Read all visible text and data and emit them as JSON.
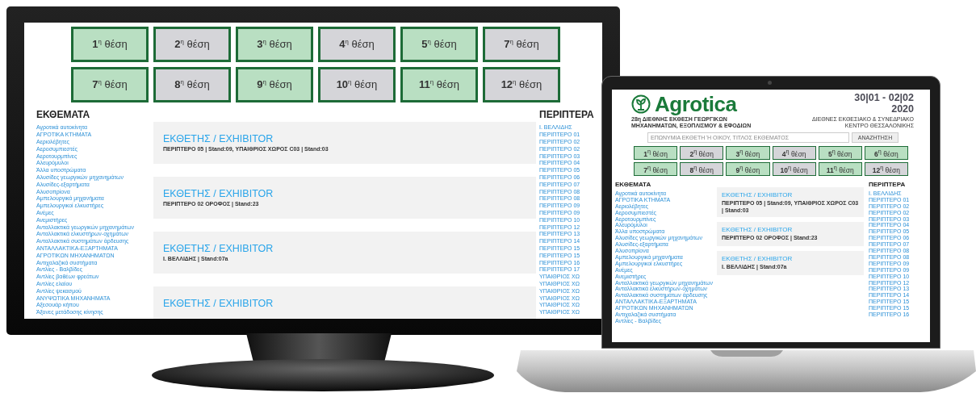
{
  "monitor": {
    "position_buttons": [
      {
        "label": "**1**$^{η}$ θέση",
        "highlighted": true
      },
      {
        "label": "**2**$^{η}$ θέση",
        "highlighted": false
      },
      {
        "label": "**3**$^{η}$ θέση",
        "highlighted": true
      },
      {
        "label": "**4**$^{η}$ θέση",
        "highlighted": false
      },
      {
        "label": "**5**$^{η}$ θέση",
        "highlighted": true
      },
      {
        "label": "**7**$^{η}$ θέση",
        "highlighted": false
      },
      {
        "label": "**7**$^{η}$ θέση",
        "highlighted": true
      },
      {
        "label": "**8**$^{η}$ θέση",
        "highlighted": false
      },
      {
        "label": "**9**$^{η}$ θέση",
        "highlighted": true
      },
      {
        "label": "**10**$^{η}$ θέση",
        "highlighted": false
      },
      {
        "label": "**11**$^{η}$ θέση",
        "highlighted": true
      },
      {
        "label": "**12**$^{η}$ θέση",
        "highlighted": false
      }
    ],
    "exhibits": {
      "title": "ΕΚΘΕΜΑΤΑ",
      "items": [
        "Αγροτικά αυτοκίνητα",
        "ΑΓΡΟΤΙΚΑ ΚΤΗΜΑΤΑ",
        "Αεριολέβητες",
        "Αεροσυμπιεστές",
        "Αεροτουρμπίνες",
        "Αλευρόμυλοι",
        "Άλλα υποστρώματα",
        "Αλυσίδες γεωργικών μηχανημάτων",
        "Αλυσίδες-εξαρτήματα",
        "Αλυσοπρίονα",
        "Αμπελουργικά μηχανήματα",
        "Αμπελουργικοί ελκυστήρες",
        "Ανέμες",
        "Ανεμιστήρες",
        "Ανταλλακτικά γεωργικών μηχανημάτων",
        "Ανταλλακτικά ελκυστήρων-οχημάτων",
        "Ανταλλακτικά συστημάτων άρδευσης",
        "ΑΝΤΑΛΛΑΚΤΙΚΑ-ΕΞΑΡΤΗΜΑΤΑ ΑΓΡΟΤΙΚΩΝ ΜΗΧΑΝΗΜΑΤΩΝ",
        "Αντιχαλαζικά συστήματα",
        "Αντλίες - Βαλβίδες",
        "Αντλίες βαθέων φρεάτων",
        "Αντλίες ελαίου",
        "Αντλίες ψεκασμού",
        "ΑΝΥΨΩΤΙΚΑ ΜΗΧΑΝΗΜΑΤΑ",
        "Αξεσουάρ κήπου",
        "Άξονες μετάδοσης κίνησης"
      ]
    },
    "exhibitors": [
      {
        "title": "ΕΚΘΕΤΗΣ / EXHIBITOR",
        "location": "ΠΕΡΙΠΤΕΡΟ 05 | Stand:09, ΥΠΑΙΘΡΙΟΣ ΧΩΡΟΣ C03 | Stand:03"
      },
      {
        "title": "ΕΚΘΕΤΗΣ / EXHIBITOR",
        "location": "ΠΕΡΙΠΤΕΡΟ 02 ΟΡΟΦΟΣ | Stand:23"
      },
      {
        "title": "ΕΚΘΕΤΗΣ / EXHIBITOR",
        "location": "Ι. ΒΕΛΛΙΔΗΣ | Stand:07a"
      },
      {
        "title": "ΕΚΘΕΤΗΣ / EXHIBITOR"
      }
    ],
    "booths": {
      "title": "ΠΕΡΙΠΤΕΡΑ",
      "items": [
        "Ι. ΒΕΛΛΙΔΗΣ",
        "ΠΕΡΙΠΤΕΡΟ 01",
        "ΠΕΡΙΠΤΕΡΟ 02",
        "ΠΕΡΙΠΤΕΡΟ 02",
        "ΠΕΡΙΠΤΕΡΟ 03",
        "ΠΕΡΙΠΤΕΡΟ 04",
        "ΠΕΡΙΠΤΕΡΟ 05",
        "ΠΕΡΙΠΤΕΡΟ 06",
        "ΠΕΡΙΠΤΕΡΟ 07",
        "ΠΕΡΙΠΤΕΡΟ 08",
        "ΠΕΡΙΠΤΕΡΟ 08",
        "ΠΕΡΙΠΤΕΡΟ 09",
        "ΠΕΡΙΠΤΕΡΟ 09",
        "ΠΕΡΙΠΤΕΡΟ 10",
        "ΠΕΡΙΠΤΕΡΟ 12",
        "ΠΕΡΙΠΤΕΡΟ 13",
        "ΠΕΡΙΠΤΕΡΟ 14",
        "ΠΕΡΙΠΤΕΡΟ 15",
        "ΠΕΡΙΠΤΕΡΟ 15",
        "ΠΕΡΙΠΤΕΡΟ 16",
        "ΠΕΡΙΠΤΕΡΟ 17",
        "ΥΠΑΙΘΡΙΟΣ ΧΩ",
        "ΥΠΑΙΘΡΙΟΣ ΧΩ",
        "ΥΠΑΙΘΡΙΟΣ ΧΩ",
        "ΥΠΑΙΘΡΙΟΣ ΧΩ",
        "ΥΠΑΙΘΡΙΟΣ ΧΩ",
        "ΥΠΑΙΘΡΙΟΣ ΧΩ"
      ]
    }
  },
  "laptop": {
    "logo": "Agrotica",
    "dates": "30|01 - 02|02",
    "year": "2020",
    "event_title": "28η ΔΙΕΘΝΗΣ ΕΚΘΕΣΗ ΓΕΩΡΓΙΚΩΝ ΜΗΧΑΝΗΜΑΤΩΝ, ΕΞΟΠΛΙΣΜΟΥ & ΕΦΟΔΙΩΝ",
    "venue": "ΔΙΕΘΝΕΣ ΕΚΘΕΣΙΑΚΟ & ΣΥΝΕΔΡΙΑΚΟ ΚΕΝΤΡΟ ΘΕΣΣΑΛΟΝΙΚΗΣ",
    "search": {
      "placeholder": "ΕΠΩΝΥΜΙΑ ΕΚΘΕΤΗ Ή ΟΙΚΟΥ, ΤΙΤΛΟΣ ΕΚΘΕΜΑΤΟΣ",
      "button": "ΑΝΑΖΗΤΗΣΗ"
    },
    "position_buttons": [
      {
        "label": "**1**$^{η}$ θέση",
        "highlighted": true
      },
      {
        "label": "**2**$^{η}$ θέση",
        "highlighted": false
      },
      {
        "label": "**3**$^{η}$ θέση",
        "highlighted": true
      },
      {
        "label": "**4**$^{η}$ θέση",
        "highlighted": false
      },
      {
        "label": "**5**$^{η}$ θέση",
        "highlighted": true
      },
      {
        "label": "**6**$^{η}$ θέση",
        "highlighted": true
      },
      {
        "label": "**7**$^{η}$ θέση",
        "highlighted": true
      },
      {
        "label": "**8**$^{η}$ θέση",
        "highlighted": false
      },
      {
        "label": "**9**$^{η}$ θέση",
        "highlighted": true
      },
      {
        "label": "**10**$^{η}$ θέση",
        "highlighted": false
      },
      {
        "label": "**11**$^{η}$ θέση",
        "highlighted": true
      },
      {
        "label": "**12**$^{η}$ θέση",
        "highlighted": false
      }
    ],
    "exhibits": {
      "title": "ΕΚΘΕΜΑΤΑ",
      "items": [
        "Αγροτικά αυτοκίνητα",
        "ΑΓΡΟΤΙΚΑ ΚΤΗΜΑΤΑ",
        "Αεριολέβητες",
        "Αεροσυμπιεστές",
        "Αεροτουρμπίνες",
        "Αλευρόμυλοι",
        "Άλλα υποστρώματα",
        "Αλυσίδες γεωργικών μηχανημάτων",
        "Αλυσίδες-εξαρτήματα",
        "Αλυσοπρίονα",
        "Αμπελουργικά μηχανήματα",
        "Αμπελουργικοί ελκυστήρες",
        "Ανέμες",
        "Ανεμιστήρες",
        "Ανταλλακτικά γεωργικών μηχανημάτων",
        "Ανταλλακτικά ελκυστήρων-οχημάτων",
        "Ανταλλακτικά συστημάτων άρδευσης",
        "ΑΝΤΑΛΛΑΚΤΙΚΑ-ΕΞΑΡΤΗΜΑΤΑ ΑΓΡΟΤΙΚΩΝ ΜΗΧΑΝΗΜΑΤΩΝ",
        "Αντιχαλαζικά συστήματα",
        "Αντλίες - Βαλβίδες"
      ]
    },
    "exhibitors": [
      {
        "title": "ΕΚΘΕΤΗΣ / EXHIBITOR",
        "location": "ΠΕΡΙΠΤΕΡΟ 05 | Stand:09, ΥΠΑΙΘΡΙΟΣ ΧΩΡΟΣ C03 | Stand:03"
      },
      {
        "title": "ΕΚΘΕΤΗΣ / EXHIBITOR",
        "location": "ΠΕΡΙΠΤΕΡΟ 02 ΟΡΟΦΟΣ | Stand:23"
      },
      {
        "title": "ΕΚΘΕΤΗΣ / EXHIBITOR",
        "location": "Ι. ΒΕΛΛΙΔΗΣ | Stand:07a"
      }
    ],
    "booths": {
      "title": "ΠΕΡΙΠΤΕΡΑ",
      "items": [
        "Ι. ΒΕΛΛΙΔΗΣ",
        "ΠΕΡΙΠΤΕΡΟ 01",
        "ΠΕΡΙΠΤΕΡΟ 02",
        "ΠΕΡΙΠΤΕΡΟ 02",
        "ΠΕΡΙΠΤΕΡΟ 03",
        "ΠΕΡΙΠΤΕΡΟ 04",
        "ΠΕΡΙΠΤΕΡΟ 05",
        "ΠΕΡΙΠΤΕΡΟ 06",
        "ΠΕΡΙΠΤΕΡΟ 07",
        "ΠΕΡΙΠΤΕΡΟ 08",
        "ΠΕΡΙΠΤΕΡΟ 08",
        "ΠΕΡΙΠΤΕΡΟ 09",
        "ΠΕΡΙΠΤΕΡΟ 09",
        "ΠΕΡΙΠΤΕΡΟ 10",
        "ΠΕΡΙΠΤΕΡΟ 12",
        "ΠΕΡΙΠΤΕΡΟ 13",
        "ΠΕΡΙΠΤΕΡΟ 14",
        "ΠΕΡΙΠΤΕΡΟ 15",
        "ΠΕΡΙΠΤΕΡΟ 15",
        "ΠΕΡΙΠΤΕΡΟ 16"
      ]
    }
  }
}
